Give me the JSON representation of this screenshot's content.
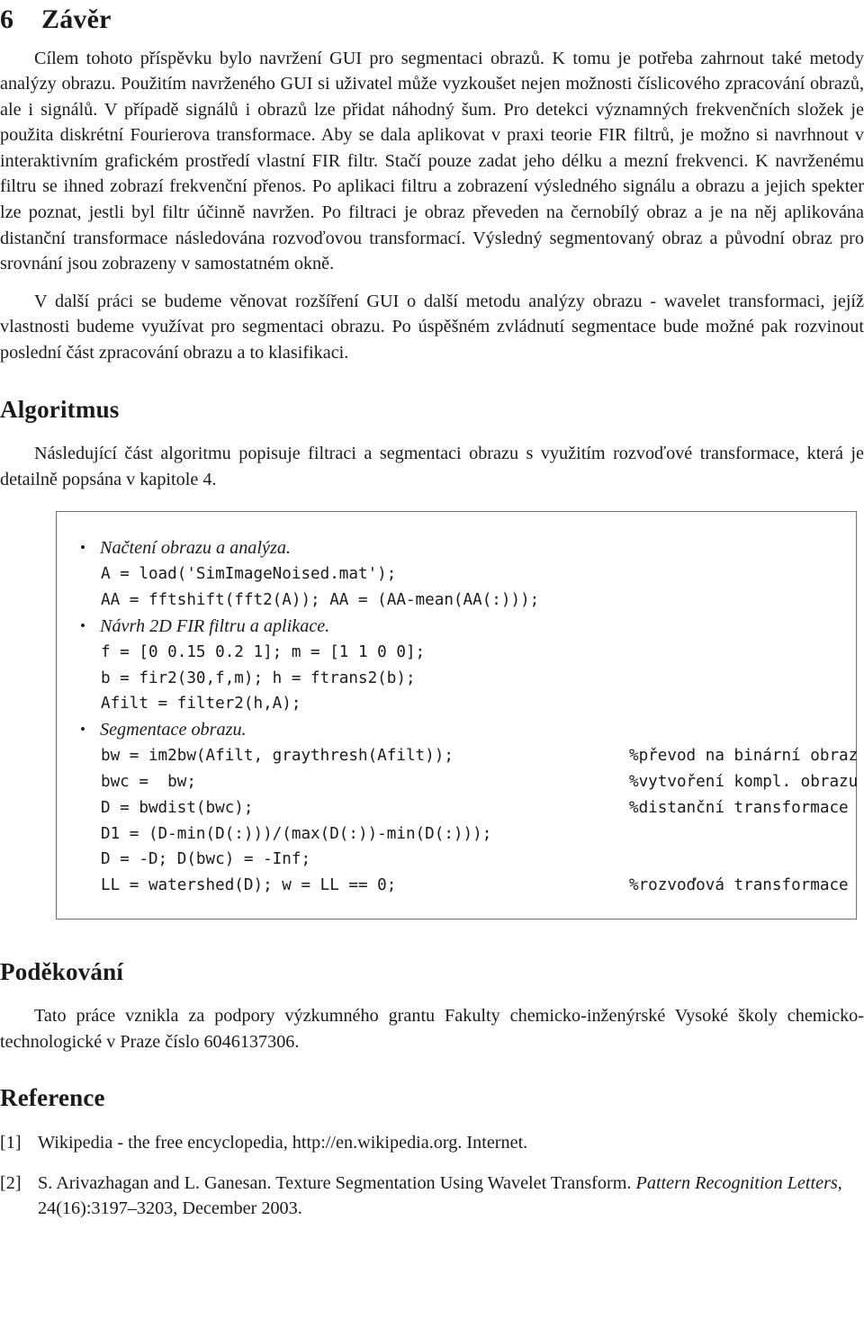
{
  "document": {
    "section": {
      "number": "6",
      "title": "Závěr"
    },
    "conclusion_paragraph_1": "Cílem tohoto příspěvku bylo navržení GUI pro segmentaci obrazů. K tomu je potřeba zahrnout také metody analýzy obrazu. Použitím navrženého GUI si uživatel může vyzkoušet nejen možnosti číslicového zpracování obrazů, ale i signálů. V případě signálů i obrazů lze přidat náhodný šum. Pro detekci významných frekvenčních složek je použita diskrétní Fourierova transformace. Aby se dala aplikovat v praxi teorie FIR filtrů, je možno si navrhnout v interaktivním grafickém prostředí vlastní FIR filtr. Stačí pouze zadat jeho délku a mezní frekvenci. K navrženému filtru se ihned zobrazí frekvenční přenos. Po aplikaci filtru a zobrazení výsledného signálu a obrazu a jejich spekter lze poznat, jestli byl filtr účinně navržen. Po filtraci je obraz převeden na černobílý obraz a je na něj aplikována distanční transformace následována rozvoďovou transformací. Výsledný segmentovaný obraz a původní obraz pro srovnání jsou zobrazeny v samostatném okně.",
    "conclusion_paragraph_2": "V další práci se budeme věnovat rozšíření GUI o další metodu analýzy obrazu - wavelet transformaci, jejíž vlastnosti budeme využívat pro segmentaci obrazu. Po úspěšném zvládnutí segmentace bude možné pak rozvinout poslední část zpracování obrazu a to klasifikaci.",
    "algorithm": {
      "heading": "Algoritmus",
      "intro_paragraph": "Následující část algoritmu popisuje filtraci a segmentaci obrazu s využitím rozvoďové transformace, která je detailně popsána v kapitole 4.",
      "items": [
        {
          "title": "Načtení obrazu a analýza.",
          "lines": [
            {
              "code": "A = load('SimImageNoised.mat');",
              "comment": ""
            },
            {
              "code": "AA = fftshift(fft2(A)); AA = (AA-mean(AA(:)));",
              "comment": ""
            }
          ]
        },
        {
          "title": "Návrh 2D FIR filtru a aplikace.",
          "lines": [
            {
              "code": "f = [0 0.15 0.2 1]; m = [1 1 0 0];",
              "comment": ""
            },
            {
              "code": "b = fir2(30,f,m); h = ftrans2(b);",
              "comment": ""
            },
            {
              "code": "Afilt = filter2(h,A);",
              "comment": ""
            }
          ]
        },
        {
          "title": "Segmentace obrazu.",
          "lines": [
            {
              "code": "bw = im2bw(Afilt, graythresh(Afilt));",
              "comment": "%převod na binární obraz"
            },
            {
              "code": "bwc =  bw;",
              "comment": "%vytvoření kompl. obrazu"
            },
            {
              "code": "D = bwdist(bwc);",
              "comment": "%distanční transformace"
            },
            {
              "code": "D1 = (D-min(D(:)))/(max(D(:))-min(D(:)));",
              "comment": ""
            },
            {
              "code": "D = -D; D(bwc) = -Inf;",
              "comment": ""
            },
            {
              "code": "LL = watershed(D); w = LL == 0;",
              "comment": "%rozvoďová transformace"
            }
          ]
        }
      ]
    },
    "acknowledgement": {
      "heading": "Poděkování",
      "text": "Tato práce vznikla za podpory výzkumného grantu Fakulty chemicko-inženýrské Vysoké školy chemicko-technologické v Praze číslo 6046137306."
    },
    "references": {
      "heading": "Reference",
      "items": [
        {
          "label": "[1]",
          "text_before_italic": "Wikipedia - the free encyclopedia, http://en.wikipedia.org. Internet.",
          "italic": "",
          "text_after_italic": ""
        },
        {
          "label": "[2]",
          "text_before_italic": "S. Arivazhagan and L. Ganesan. Texture Segmentation Using Wavelet Transform. ",
          "italic": "Pattern Recognition Letters",
          "text_after_italic": ", 24(16):3197–3203, December 2003."
        }
      ]
    }
  }
}
